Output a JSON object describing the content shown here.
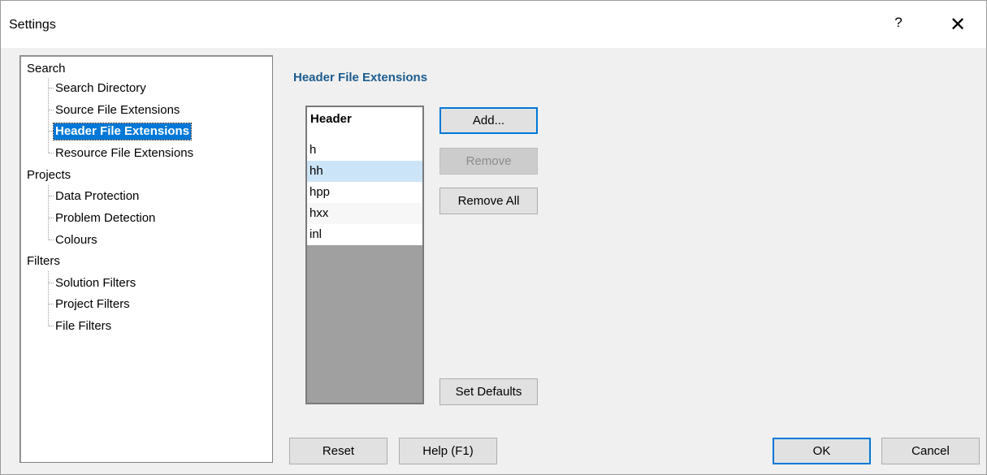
{
  "window": {
    "title": "Settings",
    "help_glyph": "?",
    "close_glyph": "✕"
  },
  "tree": {
    "groups": [
      {
        "label": "Search",
        "children": [
          "Search Directory",
          "Source File Extensions",
          "Header File Extensions",
          "Resource File Extensions"
        ]
      },
      {
        "label": "Projects",
        "children": [
          "Data Protection",
          "Problem Detection",
          "Colours"
        ]
      },
      {
        "label": "Filters",
        "children": [
          "Solution Filters",
          "Project Filters",
          "File Filters"
        ]
      }
    ],
    "selected": "Header File Extensions"
  },
  "panel": {
    "title": "Header File Extensions",
    "list": {
      "header": "Header",
      "rows": [
        "h",
        "hh",
        "hpp",
        "hxx",
        "inl"
      ],
      "selected_row": "hh"
    },
    "buttons": {
      "add": "Add...",
      "remove": "Remove",
      "remove_all": "Remove All",
      "set_defaults": "Set Defaults"
    }
  },
  "footer": {
    "reset": "Reset",
    "help": "Help (F1)",
    "ok": "OK",
    "cancel": "Cancel"
  },
  "colors": {
    "selection": "#0078d7",
    "section_title": "#1c5c8f",
    "list_selection": "#cce4f7"
  }
}
